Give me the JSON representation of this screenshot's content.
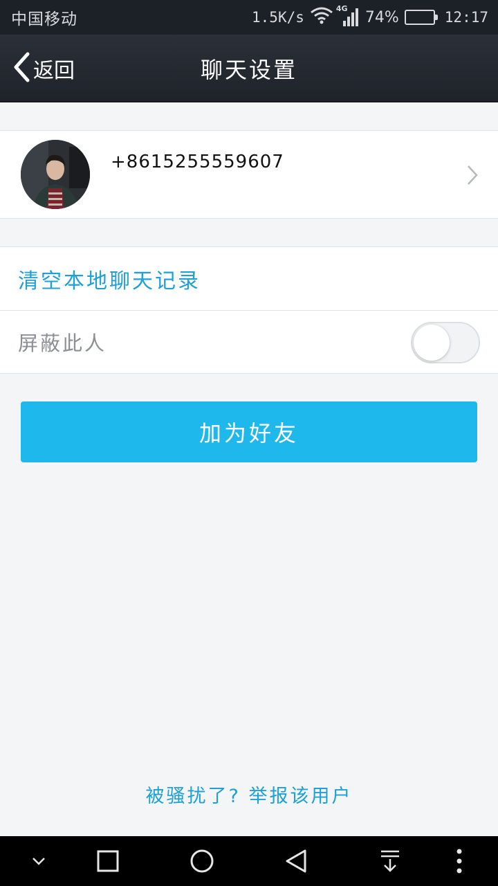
{
  "status_bar": {
    "carrier": "中国移动",
    "net_speed": "1.5K/s",
    "network_type": "4G",
    "battery_percent": "74%",
    "battery_level": 0.74,
    "time": "12:17",
    "icons": [
      "wifi-icon",
      "signal-icon",
      "battery-icon"
    ]
  },
  "header": {
    "back_label": "返回",
    "title": "聊天设置"
  },
  "profile": {
    "phone": "+8615255559607"
  },
  "settings": {
    "clear_history_label": "清空本地聊天记录",
    "block_label": "屏蔽此人",
    "block_enabled": false
  },
  "actions": {
    "add_friend_label": "加为好友",
    "report_label": "被骚扰了? 举报该用户"
  },
  "colors": {
    "accent": "#1eb8ec",
    "link": "#1ea0d6",
    "header_bg": "#262a31",
    "page_bg": "#f4f5f7"
  },
  "nav_bar": {
    "icons": [
      "chevron-down-icon",
      "recents-icon",
      "home-icon",
      "back-icon",
      "notification-pull-icon",
      "more-icon"
    ]
  }
}
